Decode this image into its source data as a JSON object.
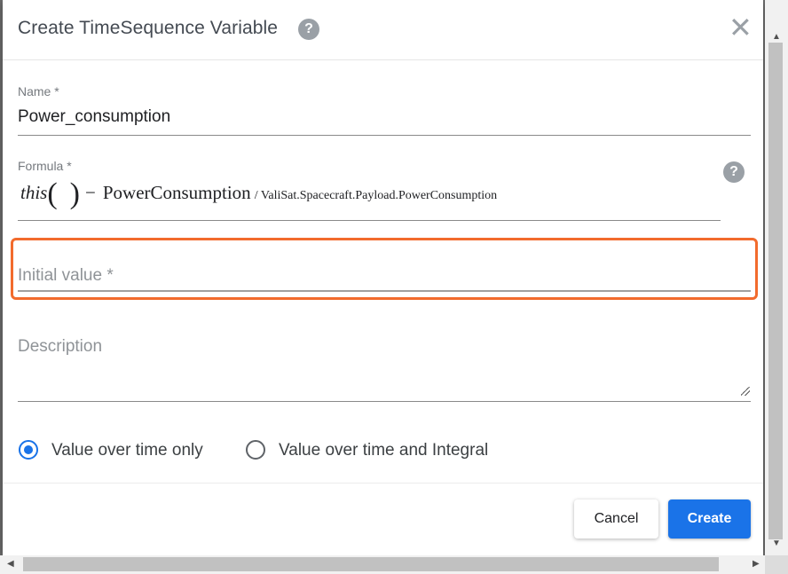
{
  "dialog": {
    "title": "Create TimeSequence Variable",
    "help_glyph": "?",
    "close_glyph": "✕"
  },
  "name_field": {
    "label": "Name *",
    "value": "Power_consumption"
  },
  "formula_field": {
    "label": "Formula *",
    "help_glyph": "?",
    "this_text": "this",
    "open_paren": "(",
    "close_paren": ")",
    "minus": "−",
    "variable_name": "PowerConsumption",
    "path": "/ ValiSat.Spacecraft.Payload.PowerConsumption"
  },
  "initial_value_field": {
    "placeholder": "Initial value *"
  },
  "description_field": {
    "placeholder": "Description"
  },
  "radio_options": [
    {
      "label": "Value over time only",
      "checked": true
    },
    {
      "label": "Value over time and Integral",
      "checked": false
    }
  ],
  "buttons": {
    "cancel": "Cancel",
    "create": "Create"
  },
  "scroll_arrows": {
    "up": "▲",
    "down": "▼",
    "left": "◀",
    "right": "▶"
  },
  "colors": {
    "accent": "#1a73e8",
    "highlight": "#f26b2d"
  },
  "icons": [
    "help-icon",
    "close-icon"
  ]
}
